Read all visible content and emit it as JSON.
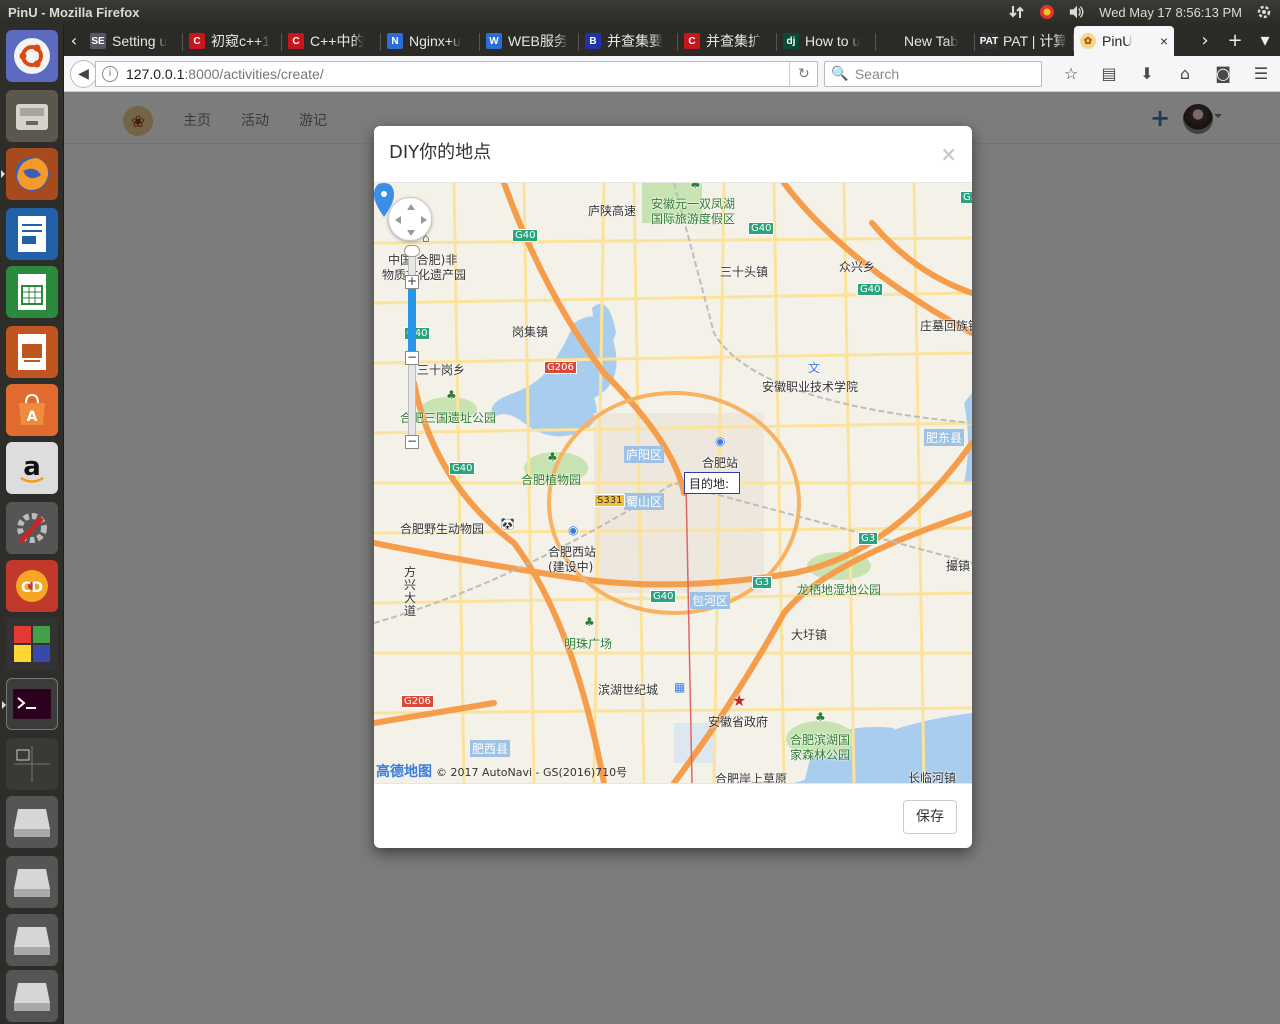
{
  "panel": {
    "window_title": "PinU - Mozilla Firefox",
    "datetime": "Wed May 17  8:56:13 PM"
  },
  "launcher": {
    "apps": [
      "ubuntu-dash-icon",
      "files-icon",
      "firefox-icon",
      "writer-icon",
      "calc-icon",
      "impress-icon",
      "software-center-icon",
      "amazon-icon",
      "system-settings-icon",
      "disc-burner-icon",
      "workspace-switcher-icon",
      "terminal-icon",
      "workspaces-icon",
      "drive-icon",
      "drive-icon",
      "drive-icon",
      "trash-icon"
    ]
  },
  "browser": {
    "tabs": [
      {
        "label": "Setting u",
        "favicon": "SE",
        "color": "#556"
      },
      {
        "label": "初窥c++1",
        "favicon": "C",
        "color": "#c8161d"
      },
      {
        "label": "C++中的",
        "favicon": "C",
        "color": "#c8161d"
      },
      {
        "label": "Nginx+u",
        "favicon": "N",
        "color": "#2b6ed8"
      },
      {
        "label": "WEB服务",
        "favicon": "W",
        "color": "#2b6ed8"
      },
      {
        "label": "并查集要",
        "favicon": "B",
        "color": "#2233aa"
      },
      {
        "label": "并查集扩",
        "favicon": "C",
        "color": "#c8161d"
      },
      {
        "label": "How to u",
        "favicon": "dj",
        "color": "#0c4b33"
      },
      {
        "label": "New Tab",
        "favicon": "",
        "color": "transparent"
      },
      {
        "label": "PAT | 计算",
        "favicon": "PAT",
        "color": "#333"
      }
    ],
    "active_tab": {
      "label": "PinU",
      "favicon_color": "#e8a33a"
    },
    "url_host": "127.0.0.1",
    "url_path": ":8000/activities/create/",
    "search_placeholder": "Search"
  },
  "site": {
    "nav": [
      "主页",
      "活动",
      "游记"
    ]
  },
  "modal": {
    "title": "DIY你的地点",
    "close": "×",
    "save_button": "保存",
    "destination_label": "目的地:"
  },
  "map": {
    "copyright_brand": "高德地图",
    "copyright_text": "© 2017 AutoNavi - GS(2016)710号",
    "labels": [
      {
        "text": "庐陕高速",
        "cls": ""
      },
      {
        "text": "安徽元一双凤湖",
        "cls": "green"
      },
      {
        "text": "国际旅游度假区",
        "cls": "green"
      },
      {
        "text": "三十头镇",
        "cls": ""
      },
      {
        "text": "众兴乡",
        "cls": ""
      },
      {
        "text": "中国(合肥)非",
        "cls": ""
      },
      {
        "text": "物质文化遗产园",
        "cls": ""
      },
      {
        "text": "岗集镇",
        "cls": ""
      },
      {
        "text": "庄墓回族镇",
        "cls": ""
      },
      {
        "text": "三十岗乡",
        "cls": ""
      },
      {
        "text": "安徽职业技术学院",
        "cls": ""
      },
      {
        "text": "合肥三国遗址公园",
        "cls": "green"
      },
      {
        "text": "肥东县",
        "cls": "district"
      },
      {
        "text": "庐阳区",
        "cls": "district"
      },
      {
        "text": "合肥站",
        "cls": ""
      },
      {
        "text": "合肥植物园",
        "cls": "green"
      },
      {
        "text": "蜀山区",
        "cls": "district"
      },
      {
        "text": "合肥野生动物园",
        "cls": ""
      },
      {
        "text": "合肥西站",
        "cls": ""
      },
      {
        "text": "(建设中)",
        "cls": ""
      },
      {
        "text": "龙栖地湿地公园",
        "cls": "green"
      },
      {
        "text": "撮镇",
        "cls": ""
      },
      {
        "text": "方兴大道",
        "cls": ""
      },
      {
        "text": "包河区",
        "cls": "district"
      },
      {
        "text": "大圩镇",
        "cls": ""
      },
      {
        "text": "明珠广场",
        "cls": "green"
      },
      {
        "text": "滨湖世纪城",
        "cls": ""
      },
      {
        "text": "安徽省政府",
        "cls": ""
      },
      {
        "text": "合肥滨湖国",
        "cls": "green"
      },
      {
        "text": "家森林公园",
        "cls": "green"
      },
      {
        "text": "肥西县",
        "cls": "district"
      },
      {
        "text": "合肥岸上草原",
        "cls": ""
      },
      {
        "text": "长临河镇",
        "cls": ""
      }
    ],
    "shields": [
      {
        "text": "G40",
        "cls": ""
      },
      {
        "text": "G40",
        "cls": ""
      },
      {
        "text": "G40",
        "cls": ""
      },
      {
        "text": "G40",
        "cls": ""
      },
      {
        "text": "G206",
        "cls": "red"
      },
      {
        "text": "G40",
        "cls": ""
      },
      {
        "text": "S331",
        "cls": "yellow"
      },
      {
        "text": "G3",
        "cls": ""
      },
      {
        "text": "G3",
        "cls": ""
      },
      {
        "text": "G40",
        "cls": ""
      },
      {
        "text": "G206",
        "cls": "red"
      },
      {
        "text": "G3",
        "cls": ""
      }
    ]
  }
}
